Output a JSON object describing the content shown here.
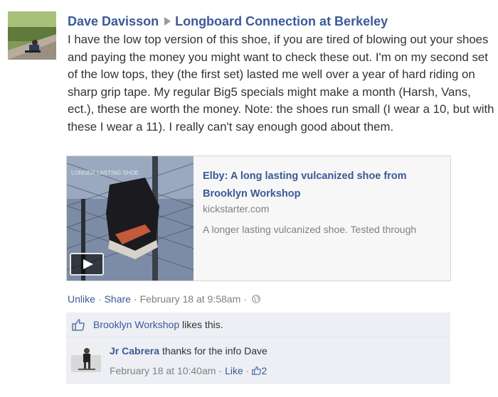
{
  "post": {
    "author": "Dave Davisson",
    "group": "Longboard Connection at Berkeley",
    "text": "I have the low top version of this shoe, if you are tired of blowing out your shoes and paying the money you might want to check these out. I'm on my second set of the low tops, they (the first set) lasted me well over a year of hard riding on sharp grip tape. My regular Big5 specials might make a month (Harsh, Vans, ect.), these are worth the money. Note: the shoes run small (I wear a 10, but with these I wear a 11). I really can't say enough good about them."
  },
  "attachment": {
    "title": "Elby: A long lasting vulcanized shoe from Brooklyn Workshop",
    "domain": "kickstarter.com",
    "description": "A longer lasting vulcanized shoe. Tested through",
    "thumb_caption": "LONGER LASTING SHOE"
  },
  "actions": {
    "unlike": "Unlike",
    "share": "Share",
    "timestamp": "February 18 at 9:58am"
  },
  "likes": {
    "liker": "Brooklyn Workshop",
    "suffix": "likes this."
  },
  "comment": {
    "author": "Jr Cabrera",
    "text": "thanks for the info Dave",
    "timestamp": "February 18 at 10:40am",
    "like_label": "Like",
    "like_count": "2"
  },
  "colors": {
    "link": "#3b5998",
    "meta": "#808080",
    "box_bg": "#edeff4"
  }
}
